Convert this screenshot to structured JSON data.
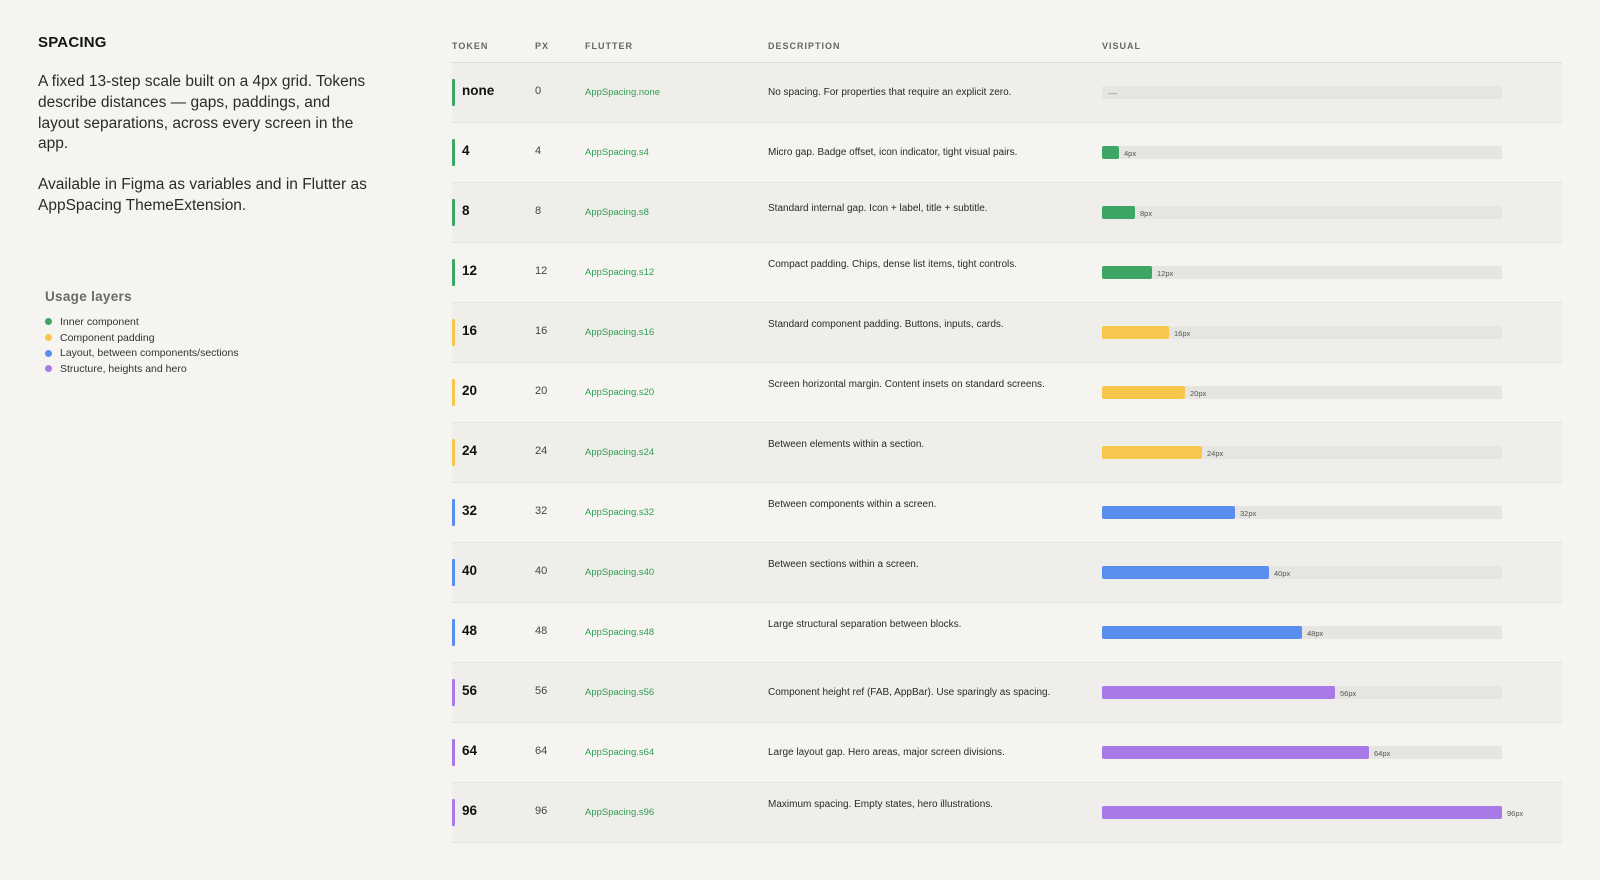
{
  "section_title": "SPACING",
  "intro": [
    "A fixed 13-step scale built on a 4px grid. Tokens describe distances — gaps, paddings, and layout separations, across every screen in the app.",
    "Available in Figma as variables and in Flutter as AppSpacing ThemeExtension."
  ],
  "legend": {
    "title": "Usage layers",
    "items": [
      {
        "label": "Inner component",
        "color": "#3fa565"
      },
      {
        "label": "Component padding",
        "color": "#f7c64c"
      },
      {
        "label": "Layout, between components/sections",
        "color": "#5b8def"
      },
      {
        "label": "Structure, heights and hero",
        "color": "#a87ae8"
      }
    ]
  },
  "table": {
    "headers": [
      "TOKEN",
      "PX",
      "FLUTTER",
      "DESCRIPTION",
      "VISUAL"
    ],
    "rows": [
      {
        "token": "none",
        "px": "0",
        "flutter": "AppSpacing.none",
        "description": "No spacing. For properties that require an explicit zero.",
        "visual_label": "—",
        "value": 0,
        "layer": 0
      },
      {
        "token": "4",
        "px": "4",
        "flutter": "AppSpacing.s4",
        "description": "Micro gap. Badge offset, icon indicator, tight visual pairs.",
        "visual_label": "4px",
        "value": 4,
        "layer": 0
      },
      {
        "token": "8",
        "px": "8",
        "flutter": "AppSpacing.s8",
        "description": "Standard internal gap. Icon + label, title + subtitle.",
        "visual_label": "8px",
        "value": 8,
        "layer": 0
      },
      {
        "token": "12",
        "px": "12",
        "flutter": "AppSpacing.s12",
        "description": "Compact padding. Chips, dense list items, tight controls.",
        "visual_label": "12px",
        "value": 12,
        "layer": 0
      },
      {
        "token": "16",
        "px": "16",
        "flutter": "AppSpacing.s16",
        "description": "Standard component padding. Buttons, inputs, cards.",
        "visual_label": "16px",
        "value": 16,
        "layer": 1
      },
      {
        "token": "20",
        "px": "20",
        "flutter": "AppSpacing.s20",
        "description": "Screen horizontal margin. Content insets on standard screens.",
        "visual_label": "20px",
        "value": 20,
        "layer": 1
      },
      {
        "token": "24",
        "px": "24",
        "flutter": "AppSpacing.s24",
        "description": "Between elements within a section.",
        "visual_label": "24px",
        "value": 24,
        "layer": 1
      },
      {
        "token": "32",
        "px": "32",
        "flutter": "AppSpacing.s32",
        "description": "Between components within a screen.",
        "visual_label": "32px",
        "value": 32,
        "layer": 2
      },
      {
        "token": "40",
        "px": "40",
        "flutter": "AppSpacing.s40",
        "description": "Between sections within a screen.",
        "visual_label": "40px",
        "value": 40,
        "layer": 2
      },
      {
        "token": "48",
        "px": "48",
        "flutter": "AppSpacing.s48",
        "description": "Large structural separation between blocks.",
        "visual_label": "48px",
        "value": 48,
        "layer": 2
      },
      {
        "token": "56",
        "px": "56",
        "flutter": "AppSpacing.s56",
        "description": "Component height ref (FAB, AppBar). Use sparingly as spacing.",
        "visual_label": "56px",
        "value": 56,
        "layer": 3
      },
      {
        "token": "64",
        "px": "64",
        "flutter": "AppSpacing.s64",
        "description": "Large layout gap. Hero areas, major screen divisions.",
        "visual_label": "64px",
        "value": 64,
        "layer": 3
      },
      {
        "token": "96",
        "px": "96",
        "flutter": "AppSpacing.s96",
        "description": "Maximum spacing. Empty states, hero illustrations.",
        "visual_label": "96px",
        "value": 96,
        "layer": 3
      }
    ],
    "scale_max": 96
  }
}
